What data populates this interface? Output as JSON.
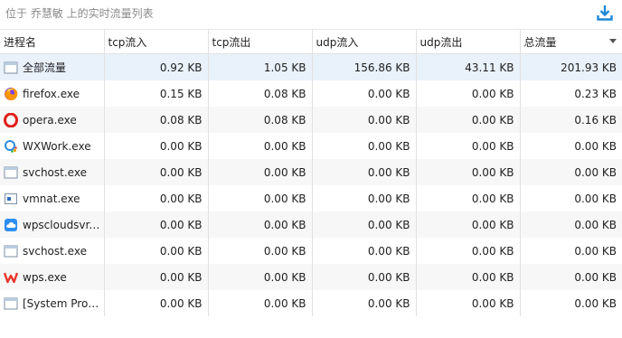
{
  "header": {
    "title": "位于 乔慧敏 上的实时流量列表",
    "download_icon": "download-icon"
  },
  "colors": {
    "accent": "#1e88d8",
    "selected_row": "#e9f1fb",
    "alt_row": "#f7f7f7"
  },
  "table": {
    "sorted_column": "总流量",
    "sort_direction": "descending",
    "columns": [
      "进程名",
      "tcp流入",
      "tcp流出",
      "udp流入",
      "udp流出",
      "总流量"
    ],
    "rows": [
      {
        "name": "全部流量",
        "icon": "window-icon",
        "tcp_in": "0.92 KB",
        "tcp_out": "1.05 KB",
        "udp_in": "156.86 KB",
        "udp_out": "43.11 KB",
        "total": "201.93 KB"
      },
      {
        "name": "firefox.exe",
        "icon": "firefox-icon",
        "tcp_in": "0.15 KB",
        "tcp_out": "0.08 KB",
        "udp_in": "0.00 KB",
        "udp_out": "0.00 KB",
        "total": "0.23 KB"
      },
      {
        "name": "opera.exe",
        "icon": "opera-icon",
        "tcp_in": "0.08 KB",
        "tcp_out": "0.08 KB",
        "udp_in": "0.00 KB",
        "udp_out": "0.00 KB",
        "total": "0.16 KB"
      },
      {
        "name": "WXWork.exe",
        "icon": "wxwork-icon",
        "tcp_in": "0.00 KB",
        "tcp_out": "0.00 KB",
        "udp_in": "0.00 KB",
        "udp_out": "0.00 KB",
        "total": "0.00 KB"
      },
      {
        "name": "svchost.exe",
        "icon": "window-icon",
        "tcp_in": "0.00 KB",
        "tcp_out": "0.00 KB",
        "udp_in": "0.00 KB",
        "udp_out": "0.00 KB",
        "total": "0.00 KB"
      },
      {
        "name": "vmnat.exe",
        "icon": "vmnat-icon",
        "tcp_in": "0.00 KB",
        "tcp_out": "0.00 KB",
        "udp_in": "0.00 KB",
        "udp_out": "0.00 KB",
        "total": "0.00 KB"
      },
      {
        "name": "wpscloudsvr....",
        "icon": "cloud-icon",
        "tcp_in": "0.00 KB",
        "tcp_out": "0.00 KB",
        "udp_in": "0.00 KB",
        "udp_out": "0.00 KB",
        "total": "0.00 KB"
      },
      {
        "name": "svchost.exe",
        "icon": "window-icon",
        "tcp_in": "0.00 KB",
        "tcp_out": "0.00 KB",
        "udp_in": "0.00 KB",
        "udp_out": "0.00 KB",
        "total": "0.00 KB"
      },
      {
        "name": "wps.exe",
        "icon": "wps-icon",
        "tcp_in": "0.00 KB",
        "tcp_out": "0.00 KB",
        "udp_in": "0.00 KB",
        "udp_out": "0.00 KB",
        "total": "0.00 KB"
      },
      {
        "name": "[System Proc...",
        "icon": "window-icon",
        "tcp_in": "0.00 KB",
        "tcp_out": "0.00 KB",
        "udp_in": "0.00 KB",
        "udp_out": "0.00 KB",
        "total": "0.00 KB"
      }
    ]
  }
}
